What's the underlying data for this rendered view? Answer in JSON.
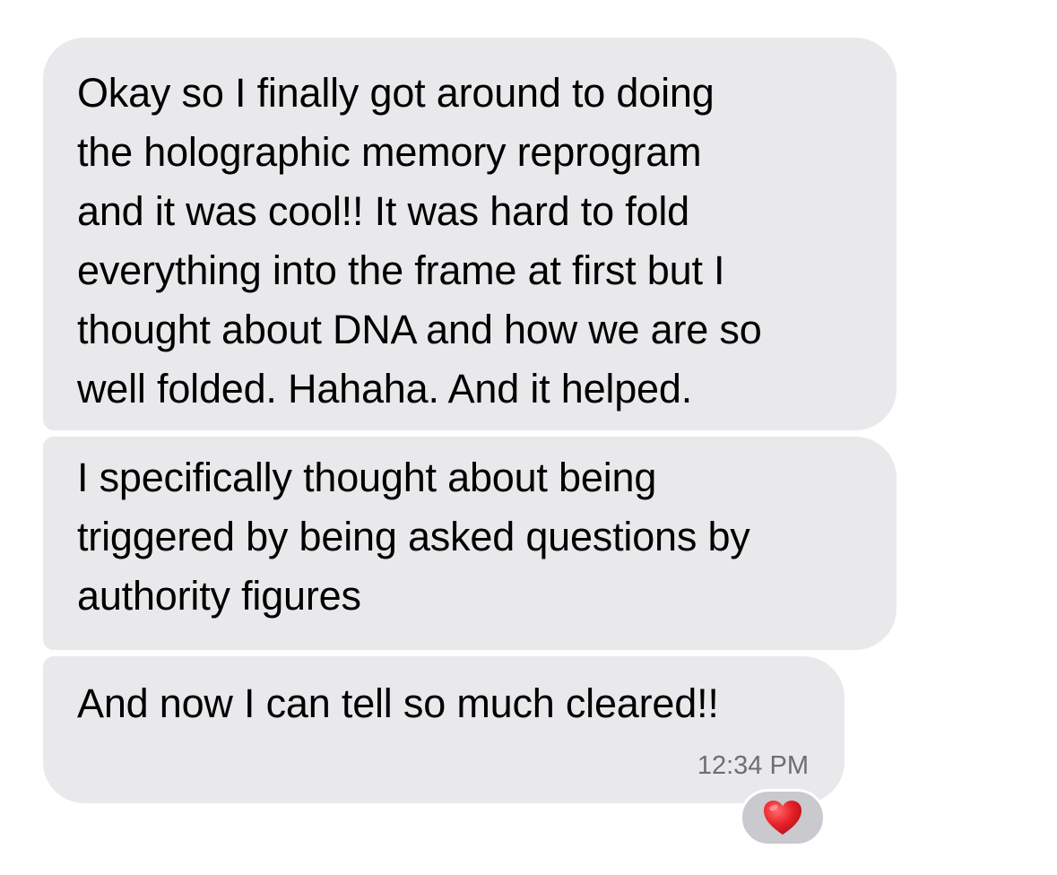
{
  "messages": [
    {
      "lines": [
        "Okay so I finally got around to doing",
        "the holographic memory reprogram",
        "and it was cool!! It was hard to fold",
        "everything into the frame at first but I",
        "thought about DNA and how we are so",
        "well folded. Hahaha. And it helped."
      ]
    },
    {
      "lines": [
        "I specifically thought about being",
        "triggered by being asked questions by",
        "authority figures"
      ]
    },
    {
      "lines": [
        "And now I can tell so much cleared!!"
      ],
      "timestamp": "12:34 PM"
    }
  ],
  "reaction": {
    "icon": "heart-icon",
    "color": "#e8202a"
  },
  "colors": {
    "bubble": "#e9e9eb",
    "text": "#000000",
    "timestamp": "#6e6e73",
    "reaction_bg": "#c9c9ce"
  }
}
